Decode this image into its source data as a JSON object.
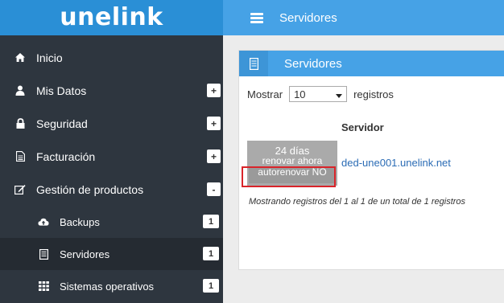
{
  "brand": {
    "logo_text": "unelink"
  },
  "header": {
    "title": "Servidores"
  },
  "sidebar": {
    "items": [
      {
        "label": "Inicio",
        "icon": "home-icon"
      },
      {
        "label": "Mis Datos",
        "icon": "user-icon",
        "toggle": "+"
      },
      {
        "label": "Seguridad",
        "icon": "lock-icon",
        "toggle": "+"
      },
      {
        "label": "Facturación",
        "icon": "document-icon",
        "toggle": "+"
      },
      {
        "label": "Gestión de productos",
        "icon": "edit-icon",
        "toggle": "-"
      }
    ],
    "subitems": [
      {
        "label": "Backups",
        "icon": "cloud-upload-icon",
        "count": "1"
      },
      {
        "label": "Servidores",
        "icon": "server-icon",
        "count": "1"
      },
      {
        "label": "Sistemas operativos",
        "icon": "grid-icon",
        "count": "1"
      }
    ]
  },
  "panel": {
    "title": "Servidores",
    "show_label": "Mostrar",
    "page_size": "10",
    "records_label": "registros",
    "column_header": "Servidor",
    "row": {
      "days": "24 días",
      "renew": "renovar ahora",
      "autorenew": "autorenovar NO",
      "server": "ded-une001.unelink.net"
    },
    "footer": "Mostrando registros del 1 al 1 de un total de 1 registros"
  },
  "colors": {
    "accent": "#46a2e6",
    "sidebar": "#2e363f",
    "highlight": "#d9242a"
  }
}
